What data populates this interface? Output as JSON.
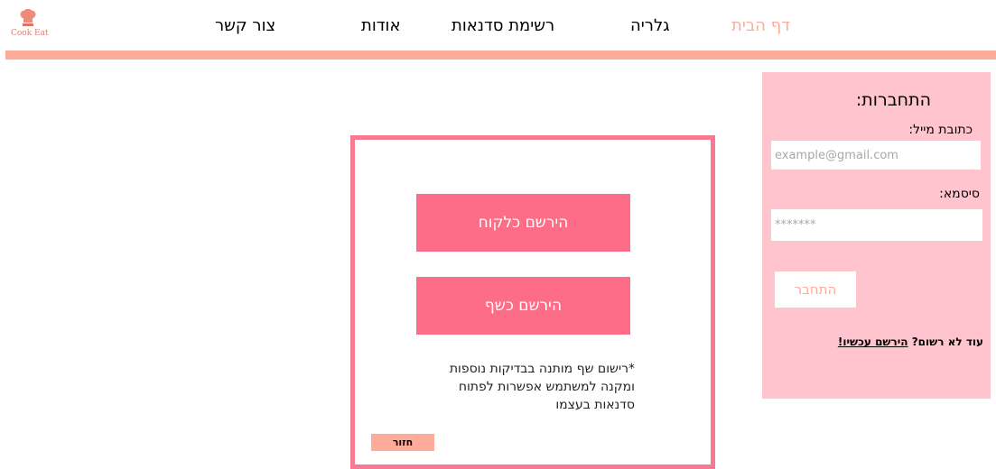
{
  "logo": {
    "text": "Cook Eat"
  },
  "nav": {
    "home": "דף הבית",
    "gallery": "גלריה",
    "workshops": "רשימת סדנאות",
    "about": "אודות",
    "contact": "צור קשר"
  },
  "login": {
    "title": "התחברות:",
    "email_label": "כתובת מייל:",
    "email_placeholder": "example@gmail.com",
    "password_label": "סיסמא:",
    "password_placeholder": "*******",
    "submit": "התחבר",
    "not_registered": "עוד לא רשום?",
    "register_now": "הירשם עכשיו!"
  },
  "register": {
    "as_client": "הירשם כלקוח",
    "as_chef": "הירשם כשף",
    "note": "*רישום שף מותנה בבדיקות נוספות ומקנה למשתמש אפשרות לפתוח סדנאות בעצמו",
    "back": "חזור"
  },
  "colors": {
    "accent": "#ffab99",
    "panel": "#ffc4ce",
    "button": "#fd6d87",
    "card_border": "#f77a92"
  }
}
